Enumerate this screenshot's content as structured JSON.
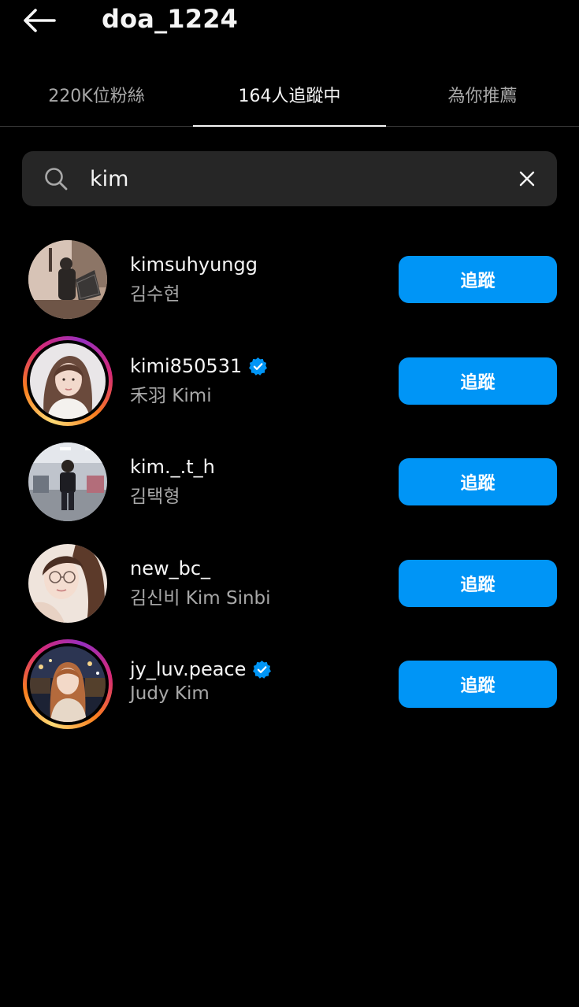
{
  "header": {
    "title": "doa_1224",
    "back_icon": "arrow-left-icon"
  },
  "tabs": [
    {
      "label": "220K位粉絲",
      "active": false
    },
    {
      "label": "164人追蹤中",
      "active": true
    },
    {
      "label": "為你推薦",
      "active": false
    }
  ],
  "search": {
    "value": "kim",
    "icon": "search-icon",
    "clear_icon": "close-icon"
  },
  "users": [
    {
      "username": "kimsuhyungg",
      "full_name": "김수현",
      "verified": false,
      "story_ring": false,
      "button_label": "追蹤"
    },
    {
      "username": "kimi850531",
      "full_name": "禾羽 Kimi",
      "verified": true,
      "story_ring": true,
      "button_label": "追蹤"
    },
    {
      "username": "kim._.t_h",
      "full_name": "김택형",
      "verified": false,
      "story_ring": false,
      "button_label": "追蹤"
    },
    {
      "username": "new_bc_",
      "full_name": "김신비 Kim Sinbi",
      "verified": false,
      "story_ring": false,
      "button_label": "追蹤"
    },
    {
      "username": "jy_luv.peace",
      "full_name": "Judy Kim",
      "verified": true,
      "story_ring": true,
      "button_label": "追蹤"
    }
  ],
  "colors": {
    "background": "#000000",
    "follow_button": "#0095f6",
    "verified_badge": "#0095f6",
    "secondary_text": "#a8a8a8",
    "search_bg": "#262626"
  }
}
